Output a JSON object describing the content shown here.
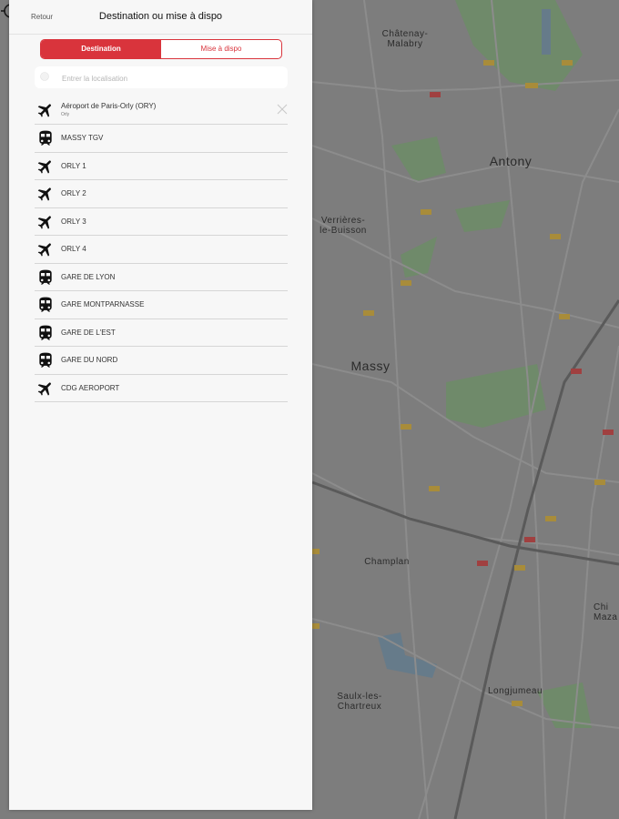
{
  "header": {
    "back_label": "Retour",
    "title": "Destination ou mise à dispo"
  },
  "segmented": {
    "options": [
      "Destination",
      "Mise à dispo"
    ],
    "selected": "Destination"
  },
  "search": {
    "placeholder": "Entrer la localisation",
    "value": ""
  },
  "colors": {
    "accent": "#d9343c",
    "panel_bg": "#f7f7f7",
    "map_overlay": "#7d7d7d"
  },
  "locations": [
    {
      "name": "Aéroport de Paris-Orly (ORY)",
      "subtitle": "Orly",
      "icon": "airplane-icon",
      "selected": true
    },
    {
      "name": "MASSY TGV",
      "icon": "train-icon"
    },
    {
      "name": "ORLY 1",
      "icon": "airplane-icon"
    },
    {
      "name": "ORLY 2",
      "icon": "airplane-icon"
    },
    {
      "name": "ORLY 3",
      "icon": "airplane-icon"
    },
    {
      "name": "ORLY 4",
      "icon": "airplane-icon"
    },
    {
      "name": "GARE DE LYON",
      "icon": "train-icon"
    },
    {
      "name": "GARE MONTPARNASSE",
      "icon": "train-icon"
    },
    {
      "name": "GARE DE L'EST",
      "icon": "train-icon"
    },
    {
      "name": "GARE DU NORD",
      "icon": "train-icon"
    },
    {
      "name": "CDG AEROPORT",
      "icon": "airplane-icon"
    }
  ],
  "map": {
    "labels": [
      "Châtenay-\nMalabry",
      "Antony",
      "Verrières-\nle-Buisson",
      "Massy",
      "Champlan",
      "Saulx-les-\nChartreux",
      "Longjumeau",
      "Chi\nMaza"
    ]
  }
}
